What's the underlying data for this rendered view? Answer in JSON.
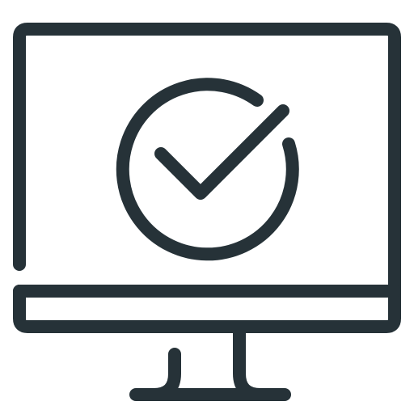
{
  "icon": {
    "name": "monitor-checkmark-icon",
    "stroke_color": "#263238",
    "background_color": "#ffffff",
    "parts": [
      "monitor-frame",
      "monitor-bottom-bar",
      "monitor-stand",
      "check-circle",
      "check-mark"
    ]
  }
}
